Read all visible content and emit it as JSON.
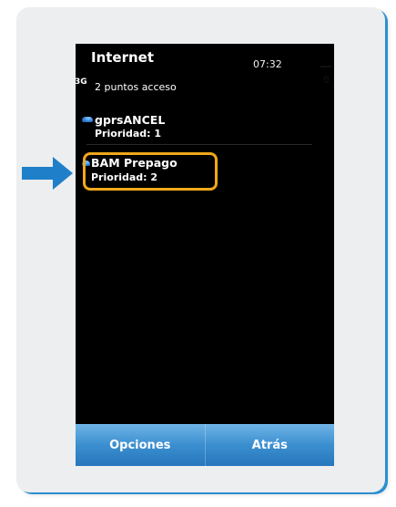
{
  "phone": {
    "title": "Internet",
    "clock": "07:32",
    "signal_indicator": "3G",
    "access_points_count": "2 puntos acceso",
    "access_points": [
      {
        "name": "gprsANCEL",
        "priority": "Prioridad: 1",
        "icon": "access-point-icon"
      },
      {
        "name": "BAM Prepago",
        "priority": "Prioridad: 2",
        "icon": "access-point-icon",
        "highlighted": true
      }
    ],
    "softkeys": {
      "left": "Opciones",
      "right": "Atrás"
    }
  },
  "side_indicator": "0",
  "colors": {
    "highlight": "#f0a81a",
    "arrow": "#1f7fc9",
    "softkey_bar": "#3b8fd0",
    "card_accent": "#2b8fd0"
  }
}
